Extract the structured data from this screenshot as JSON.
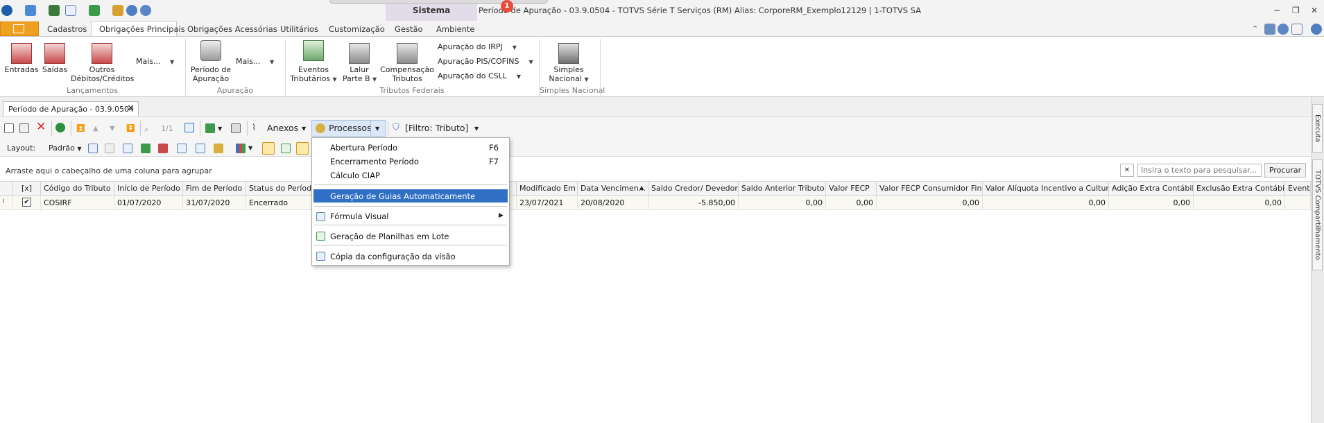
{
  "titlebar": {
    "sistema": "Sistema",
    "window_title": "Período de Apuração - 03.9.0504 - TOTVS Série T Serviços (RM) Alias: CorporeRM_Exemplo12129 | 1-TOTVS SA",
    "notification_count": "1",
    "buttons": [
      "−",
      "❐",
      "✕"
    ]
  },
  "ribbon_tabs": [
    "Cadastros",
    "Obrigações Principais",
    "Obrigações Acessórias",
    "Utilitários",
    "Customização",
    "Gestão",
    "Ambiente"
  ],
  "ribbon": {
    "lancamentos": {
      "group": "Lançamentos",
      "entradas": "Entradas",
      "saidas": "Saídas",
      "outros_1": "Outros",
      "outros_2": "Débitos/Créditos",
      "mais": "Mais..."
    },
    "apuracao": {
      "group": "Apuração",
      "periodo_1": "Período de",
      "periodo_2": "Apuração",
      "mais": "Mais..."
    },
    "tributos": {
      "group": "Tributos Federais",
      "eventos_1": "Eventos",
      "eventos_2": "Tributários",
      "lalur_1": "Lalur",
      "lalur_2": "Parte B",
      "comp_1": "Compensação",
      "comp_2": "Tributos",
      "irpj": "Apuração do IRPJ",
      "pis": "Apuração PIS/COFINS",
      "csll": "Apuração do CSLL"
    },
    "simples": {
      "group": "Simples Nacional",
      "label_1": "Simples",
      "label_2": "Nacional"
    }
  },
  "doc_tab": {
    "label": "Período de Apuração - 03.9.0504",
    "close": "✕"
  },
  "toolbar": {
    "record_counter": "1/1",
    "anexos": "Anexos",
    "processos": "Processos",
    "filtro": "[Filtro: Tributo]",
    "layout_label": "Layout:",
    "layout_value": "Padrão"
  },
  "groupbar": {
    "hint": "Arraste aqui o cabeçalho de uma coluna para agrupar",
    "search_placeholder": "Insira o texto para pesquisar...",
    "search_button": "Procurar",
    "clear": "✕"
  },
  "grid": {
    "columns": [
      "[x]",
      "Código do Tributo",
      "Início de Período",
      "Fim de Período",
      "Status do Período",
      "Modificado Em",
      "Data Vencimen...",
      "Saldo Credor/ Devedor",
      "Saldo Anterior Tributo",
      "Valor FECP",
      "Valor FECP Consumidor Final",
      "Valor Alíquota Incentivo a Cultura",
      "Adição Extra Contábil",
      "Exclusão Extra Contábil",
      "Event"
    ],
    "row": {
      "codigo": "COSIRF",
      "inicio": "01/07/2020",
      "fim": "31/07/2020",
      "status": "Encerrado",
      "modificado": "23/07/2021",
      "vencimento": "20/08/2020",
      "saldo": "-5.850,00",
      "saldo_anterior": "0,00",
      "fecp": "0,00",
      "fecp_cf": "0,00",
      "aliquota": "0,00",
      "adicao": "0,00",
      "exclusao": "0,00"
    }
  },
  "menu": {
    "items": [
      {
        "label": "Abertura Período",
        "shortcut": "F6"
      },
      {
        "label": "Encerramento Período",
        "shortcut": "F7"
      },
      {
        "label": "Cálculo CIAP",
        "shortcut": ""
      },
      {
        "label": "Geração de Guias Automaticamente",
        "shortcut": ""
      },
      {
        "label": "Fórmula Visual",
        "shortcut": ""
      },
      {
        "label": "Geração de Planilhas em Lote",
        "shortcut": ""
      },
      {
        "label": "Cópia da configuração da visão",
        "shortcut": ""
      }
    ]
  },
  "side_panel": {
    "label_1": "Executa",
    "label_2": "TOTVS Compartilhamento"
  },
  "colors": {
    "accent": "#2f6fc4",
    "file_tab": "#f0a020",
    "badge": "#e74c3c",
    "row_bg": "#f9f9f1"
  }
}
